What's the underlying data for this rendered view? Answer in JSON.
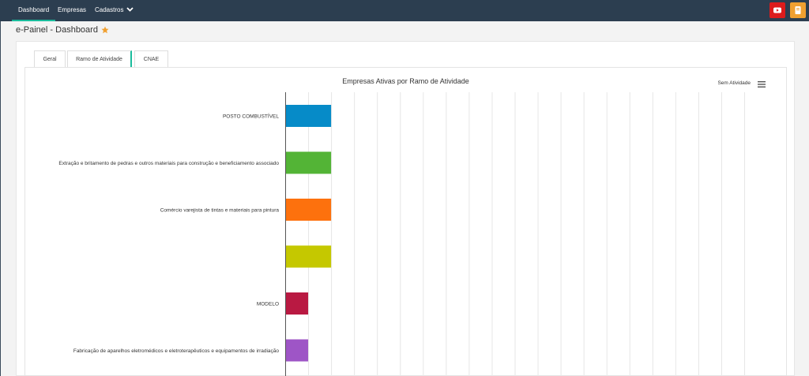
{
  "nav": {
    "items": [
      {
        "label": "Dashboard"
      },
      {
        "label": "Empresas"
      },
      {
        "label": "Cadastros"
      }
    ],
    "youtube_icon": "youtube-icon",
    "book_icon": "book-icon",
    "colors": {
      "bar_bg": "#2c3e50",
      "active_underline": "#1abc9c",
      "youtube_bg": "#dd1c1c",
      "book_bg": "#f0a030"
    }
  },
  "page": {
    "title": "e-Painel - Dashboard",
    "star_icon": "star-icon",
    "star_color": "#f0a030"
  },
  "tabs": [
    {
      "label": "Geral"
    },
    {
      "label": "Ramo de Atividade"
    },
    {
      "label": "CNAE"
    }
  ],
  "chart_data": {
    "type": "bar",
    "orientation": "horizontal",
    "title": "Empresas Ativas por Ramo de Atividade",
    "legend": {
      "label": "Sem Atividade",
      "placement": "top-right"
    },
    "grid": true,
    "xlim": [
      0,
      20
    ],
    "categories": [
      "POSTO COMBUSTÍVEL",
      "Extração e britamento de pedras e outros materiais para construção e beneficiamento associado",
      "Comércio varejista de tintas e materiais para pintura",
      "",
      "MODELO",
      "Fabricação de aparelhos eletromédicos e eletroterapêuticos e equipamentos de irradiação"
    ],
    "values": [
      2,
      2,
      2,
      2,
      1,
      1
    ],
    "colors": [
      "#068bc8",
      "#53b436",
      "#fd710d",
      "#c5c800",
      "#b91942",
      "#9e55c6"
    ]
  }
}
